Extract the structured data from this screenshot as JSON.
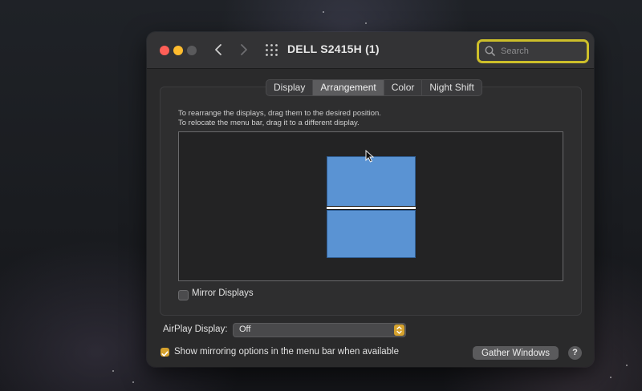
{
  "window": {
    "title": "DELL S2415H (1)"
  },
  "search": {
    "placeholder": "Search"
  },
  "tabs": [
    {
      "label": "Display"
    },
    {
      "label": "Arrangement"
    },
    {
      "label": "Color"
    },
    {
      "label": "Night Shift"
    }
  ],
  "active_tab": "Arrangement",
  "arrangement": {
    "instruction_line1": "To rearrange the displays, drag them to the desired position.",
    "instruction_line2": "To relocate the menu bar, drag it to a different display.",
    "display_color": "#5a93d3"
  },
  "mirror_displays": {
    "label": "Mirror Displays",
    "checked": false
  },
  "airplay": {
    "label": "AirPlay Display:",
    "value": "Off"
  },
  "show_mirroring": {
    "label": "Show mirroring options in the menu bar when available",
    "checked": true
  },
  "buttons": {
    "gather_windows": "Gather Windows",
    "help": "?"
  },
  "colors": {
    "accent": "#d6a22d",
    "search_focus": "#cdbf2a"
  },
  "icons": [
    "back-arrow-icon",
    "forward-arrow-icon",
    "grid-icon",
    "search-icon",
    "cursor-icon",
    "stepper-icon",
    "checkmark-icon"
  ]
}
